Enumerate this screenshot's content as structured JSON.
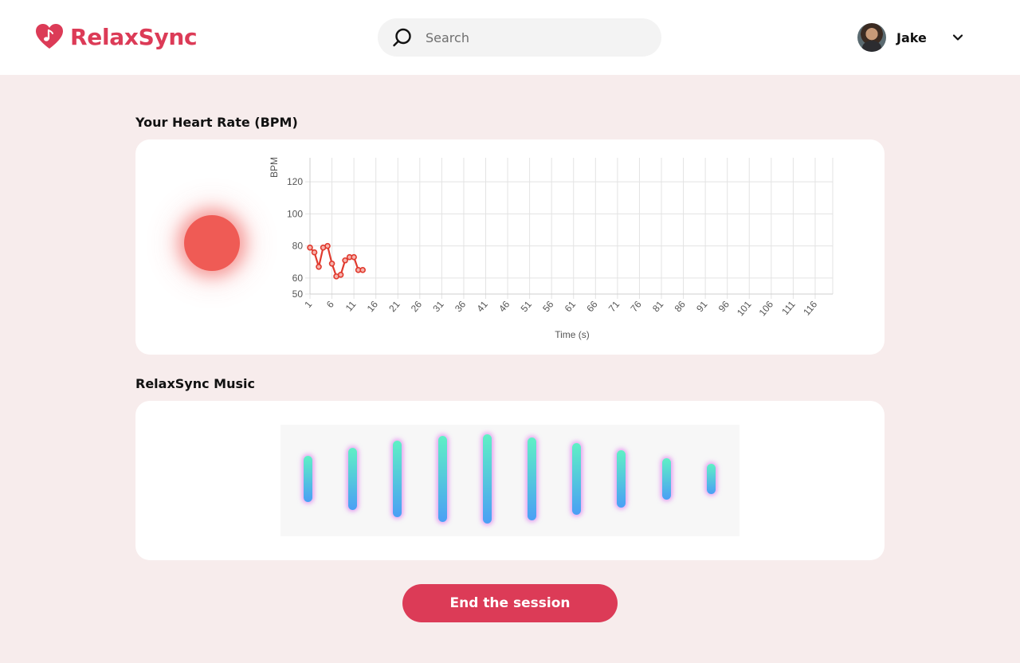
{
  "app": {
    "name": "RelaxSync",
    "brand_color": "#dc3b57"
  },
  "search": {
    "placeholder": "Search",
    "value": ""
  },
  "user": {
    "name": "Jake"
  },
  "heart_section": {
    "title": "Your Heart Rate (BPM)",
    "pulse_color": "#ef5b55"
  },
  "music_section": {
    "title": "RelaxSync Music",
    "bar_levels": [
      0.32,
      0.5,
      0.66,
      0.76,
      0.8,
      0.74,
      0.6,
      0.44,
      0.27,
      0.14
    ],
    "bar_gradient": [
      "#5ff0c5",
      "#4a9ff5"
    ],
    "bar_glow": "#d650eb"
  },
  "actions": {
    "end_session": "End the session"
  },
  "chart_data": {
    "type": "line",
    "title": "",
    "xlabel": "Time (s)",
    "ylabel": "BPM",
    "x_ticks": [
      1,
      6,
      11,
      16,
      21,
      26,
      31,
      36,
      41,
      46,
      51,
      56,
      61,
      66,
      71,
      76,
      81,
      86,
      91,
      96,
      101,
      106,
      111,
      116
    ],
    "y_ticks": [
      50,
      60,
      80,
      100,
      120
    ],
    "xlim": [
      1,
      120
    ],
    "ylim": [
      50,
      135
    ],
    "grid": true,
    "series": [
      {
        "color": "#e03a2e",
        "x": [
          1,
          2,
          3,
          4,
          5,
          6,
          7,
          8,
          9,
          10,
          11,
          12,
          13
        ],
        "y": [
          79,
          76,
          67,
          79,
          80,
          69,
          61,
          62,
          71,
          73,
          73,
          65,
          65
        ]
      }
    ]
  }
}
